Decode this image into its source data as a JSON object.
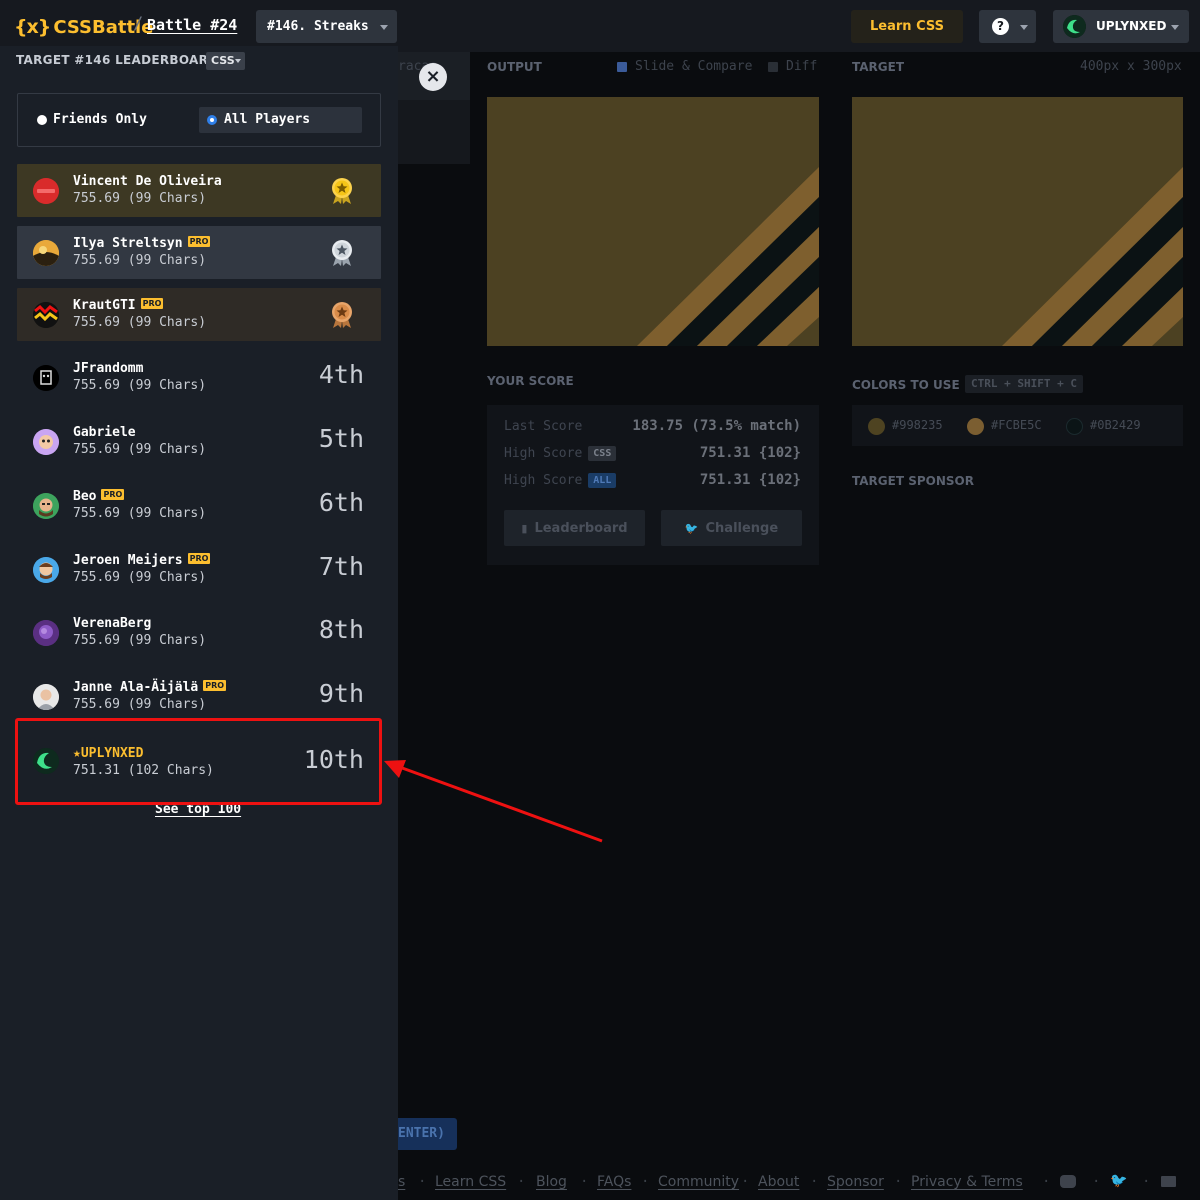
{
  "header": {
    "logo": "CSSBattle",
    "logo_mark": "{x}",
    "separator": "/",
    "battle": "Battle #24",
    "target_select": "#146. Streaks",
    "learn_css": "Learn CSS",
    "help": "?",
    "username": "UPLYNXED"
  },
  "background": {
    "tab_partial": "racas",
    "output_label": "OUTPUT",
    "slide_compare": "Slide & Compare",
    "diff": "Diff",
    "target_label": "TARGET",
    "target_size": "400px x 300px",
    "your_score": "YOUR SCORE",
    "last_score_label": "Last Score",
    "last_score_value": "183.75 (73.5% match)",
    "high_score_label": "High Score",
    "css_tag": "CSS",
    "all_tag": "ALL",
    "high_css_value": "751.31 {102}",
    "high_all_value": "751.31 {102}",
    "leaderboard_btn": "Leaderboard",
    "challenge_btn": "Challenge",
    "colors_to_use": "COLORS TO USE",
    "shortcut": "CTRL + SHIFT + C",
    "colors": [
      {
        "hex": "#998235",
        "label": "#998235"
      },
      {
        "hex": "#FCBE5C",
        "label": "#FCBE5C"
      },
      {
        "hex": "#0B2429",
        "label": "#0B2429"
      }
    ],
    "target_sponsor": "TARGET SPONSOR",
    "submit_partial": "ENTER)",
    "footer": [
      "s",
      "Learn CSS",
      "Blog",
      "FAQs",
      "Community",
      "About",
      "Sponsor",
      "Privacy & Terms"
    ]
  },
  "leaderboard": {
    "title": "TARGET #146 LEADERBOARD",
    "lang": "CSS",
    "filter_friends": "Friends Only",
    "filter_all": "All Players",
    "rows": [
      {
        "name": "Vincent De Oliveira",
        "score": "755.69 (99 Chars)",
        "rank": "1st",
        "pro": false
      },
      {
        "name": "Ilya Streltsyn",
        "score": "755.69 (99 Chars)",
        "rank": "2nd",
        "pro": true
      },
      {
        "name": "KrautGTI",
        "score": "755.69 (99 Chars)",
        "rank": "3rd",
        "pro": true
      },
      {
        "name": "JFrandomm",
        "score": "755.69 (99 Chars)",
        "rank": "4th",
        "pro": false
      },
      {
        "name": "Gabriele",
        "score": "755.69 (99 Chars)",
        "rank": "5th",
        "pro": false
      },
      {
        "name": "Beo",
        "score": "755.69 (99 Chars)",
        "rank": "6th",
        "pro": true
      },
      {
        "name": "Jeroen Meijers",
        "score": "755.69 (99 Chars)",
        "rank": "7th",
        "pro": true
      },
      {
        "name": "VerenaBerg",
        "score": "755.69 (99 Chars)",
        "rank": "8th",
        "pro": false
      },
      {
        "name": "Janne Ala-Äijälä",
        "score": "755.69 (99 Chars)",
        "rank": "9th",
        "pro": true
      }
    ],
    "pro_label": "PRO",
    "current_user": {
      "name": "★UPLYNXED",
      "score": "751.31 (102 Chars)",
      "rank": "10th"
    },
    "see_top": "See top 100"
  }
}
